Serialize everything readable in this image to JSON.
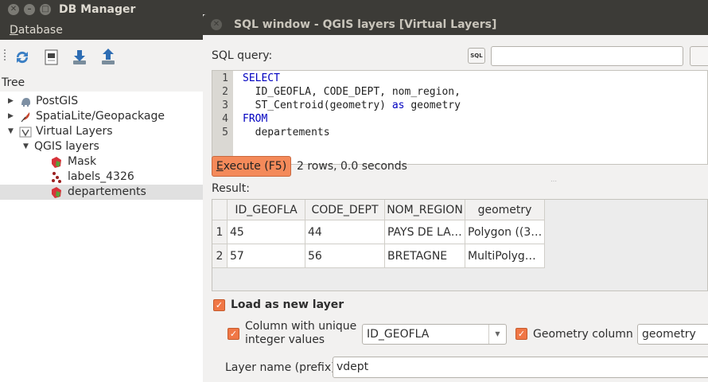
{
  "db_manager": {
    "title": "DB Manager",
    "menu": {
      "database": "Database"
    },
    "tree_label": "Tree",
    "tree": [
      {
        "label": "PostGIS",
        "expanded": false,
        "icon": "postgis-elephant-icon"
      },
      {
        "label": "SpatiaLite/Geopackage",
        "expanded": false,
        "icon": "spatialite-feather-icon"
      },
      {
        "label": "Virtual Layers",
        "expanded": true,
        "icon": "virtual-layers-icon"
      },
      {
        "label": "QGIS layers",
        "expanded": true,
        "icon": ""
      },
      {
        "label": "Mask",
        "icon": "polygon-layer-icon"
      },
      {
        "label": "labels_4326",
        "icon": "point-layer-icon"
      },
      {
        "label": "departements",
        "icon": "polygon-layer-icon",
        "selected": true
      }
    ]
  },
  "sql_window": {
    "title": "SQL window - QGIS layers [Virtual Layers]",
    "query_label": "SQL query:",
    "sql_button_text": "SQL",
    "query_lines": [
      {
        "num": "1",
        "text": "SELECT"
      },
      {
        "num": "2",
        "text": "  ID_GEOFLA, CODE_DEPT, nom_region,"
      },
      {
        "num": "3",
        "text": "  ST_Centroid(geometry) as geometry"
      },
      {
        "num": "4",
        "text": "FROM"
      },
      {
        "num": "5",
        "text": "  departements"
      }
    ],
    "execute": {
      "label_prefix": "E",
      "label_rest": "xecute (F5)"
    },
    "status": "2 rows, 0.0 seconds",
    "result_label": "Result:",
    "columns": [
      "ID_GEOFLA",
      "CODE_DEPT",
      "NOM_REGION",
      "geometry"
    ],
    "rows": [
      {
        "num": "1",
        "cells": [
          "45",
          "44",
          "PAYS DE LA…",
          "Polygon ((3…"
        ]
      },
      {
        "num": "2",
        "cells": [
          "57",
          "56",
          "BRETAGNE",
          "MultiPolyg…"
        ]
      }
    ],
    "load_as_layer": {
      "label": "Load as new layer",
      "checked": true
    },
    "unique_col": {
      "label_line1": "Column with unique",
      "label_line2": "integer values",
      "checked": true,
      "value": "ID_GEOFLA"
    },
    "geom_col": {
      "label": "Geometry column",
      "checked": true,
      "value": "geometry"
    },
    "layer_name": {
      "label": "Layer name (prefix)",
      "value": "vdept"
    }
  },
  "colors": {
    "accent": "#f07746",
    "execute_bg": "#f48a5a",
    "titlebar": "#3c3b37",
    "keyword": "#0000c0"
  }
}
